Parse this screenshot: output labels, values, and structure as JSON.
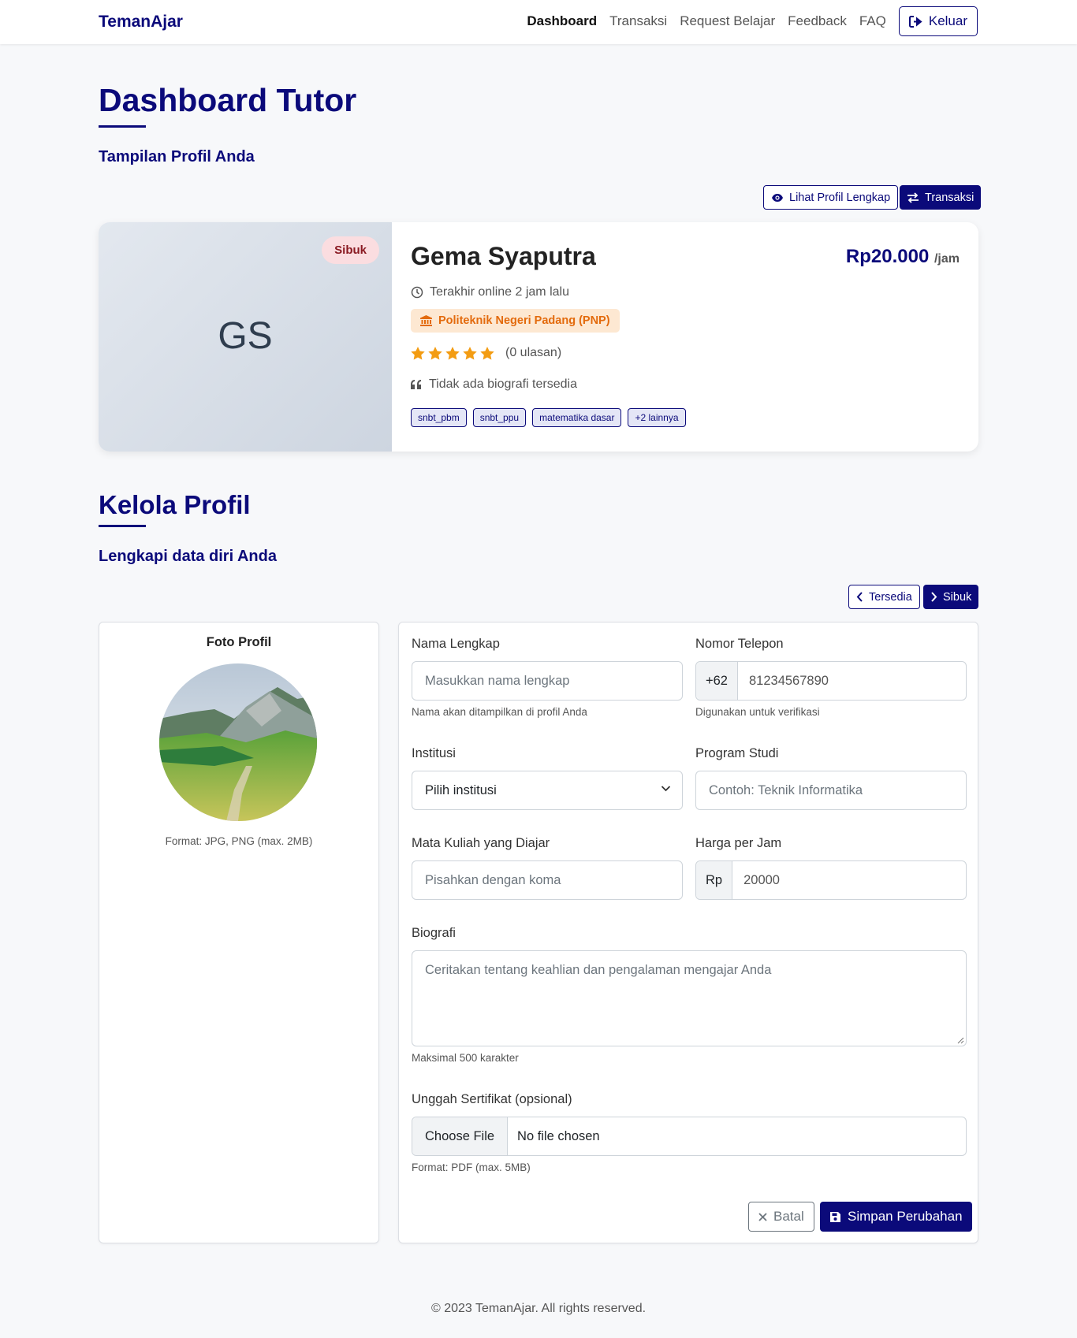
{
  "navbar": {
    "brand": "TemanAjar",
    "links": [
      "Dashboard",
      "Transaksi",
      "Request Belajar",
      "Feedback",
      "FAQ"
    ],
    "logout_label": "Keluar"
  },
  "dashboard": {
    "title": "Dashboard Tutor",
    "subtitle": "Tampilan Profil Anda",
    "view_profile_label": "Lihat Profil Lengkap",
    "transaction_label": "Transaksi"
  },
  "profile_card": {
    "initials": "GS",
    "status_badge": "Sibuk",
    "name": "Gema Syaputra",
    "price": "Rp20.000",
    "price_unit": "/jam",
    "last_online": "Terakhir online 2 jam lalu",
    "institution": "Politeknik Negeri Padang (PNP)",
    "rating": 5,
    "reviews": "(0 ulasan)",
    "bio": "Tidak ada biografi tersedia",
    "tags": [
      "snbt_pbm",
      "snbt_ppu",
      "matematika dasar",
      "+2 lainnya"
    ],
    "colors": {
      "accent": "#0b0a7a",
      "star": "#f39c12",
      "busy_bg": "#fbdde0",
      "institution_bg": "#fde8d2"
    }
  },
  "manage": {
    "title": "Kelola Profil",
    "subtitle": "Lengkapi data diri Anda",
    "available_label": "Tersedia",
    "busy_label": "Sibuk"
  },
  "photo_panel": {
    "title": "Foto Profil",
    "hint": "Format: JPG, PNG (max. 2MB)"
  },
  "form": {
    "name": {
      "label": "Nama Lengkap",
      "placeholder": "Masukkan nama lengkap",
      "help": "Nama akan ditampilkan di profil Anda"
    },
    "phone": {
      "label": "Nomor Telepon",
      "prefix": "+62",
      "value": "81234567890",
      "help": "Digunakan untuk verifikasi"
    },
    "institution": {
      "label": "Institusi",
      "selected": "Pilih institusi"
    },
    "study_program": {
      "label": "Program Studi",
      "placeholder": "Contoh: Teknik Informatika"
    },
    "courses": {
      "label": "Mata Kuliah yang Diajar",
      "placeholder": "Pisahkan dengan koma"
    },
    "hourly_price": {
      "label": "Harga per Jam",
      "prefix": "Rp",
      "value": "20000"
    },
    "biography": {
      "label": "Biografi",
      "placeholder": "Ceritakan tentang keahlian dan pengalaman mengajar Anda",
      "help": "Maksimal 500 karakter"
    },
    "certificate": {
      "label": "Unggah Sertifikat (opsional)",
      "button": "Choose File",
      "status": "No file chosen",
      "help": "Format: PDF (max. 5MB)"
    },
    "cancel_label": "Batal",
    "save_label": "Simpan Perubahan"
  },
  "footer": {
    "text": "© 2023 TemanAjar. All rights reserved."
  }
}
